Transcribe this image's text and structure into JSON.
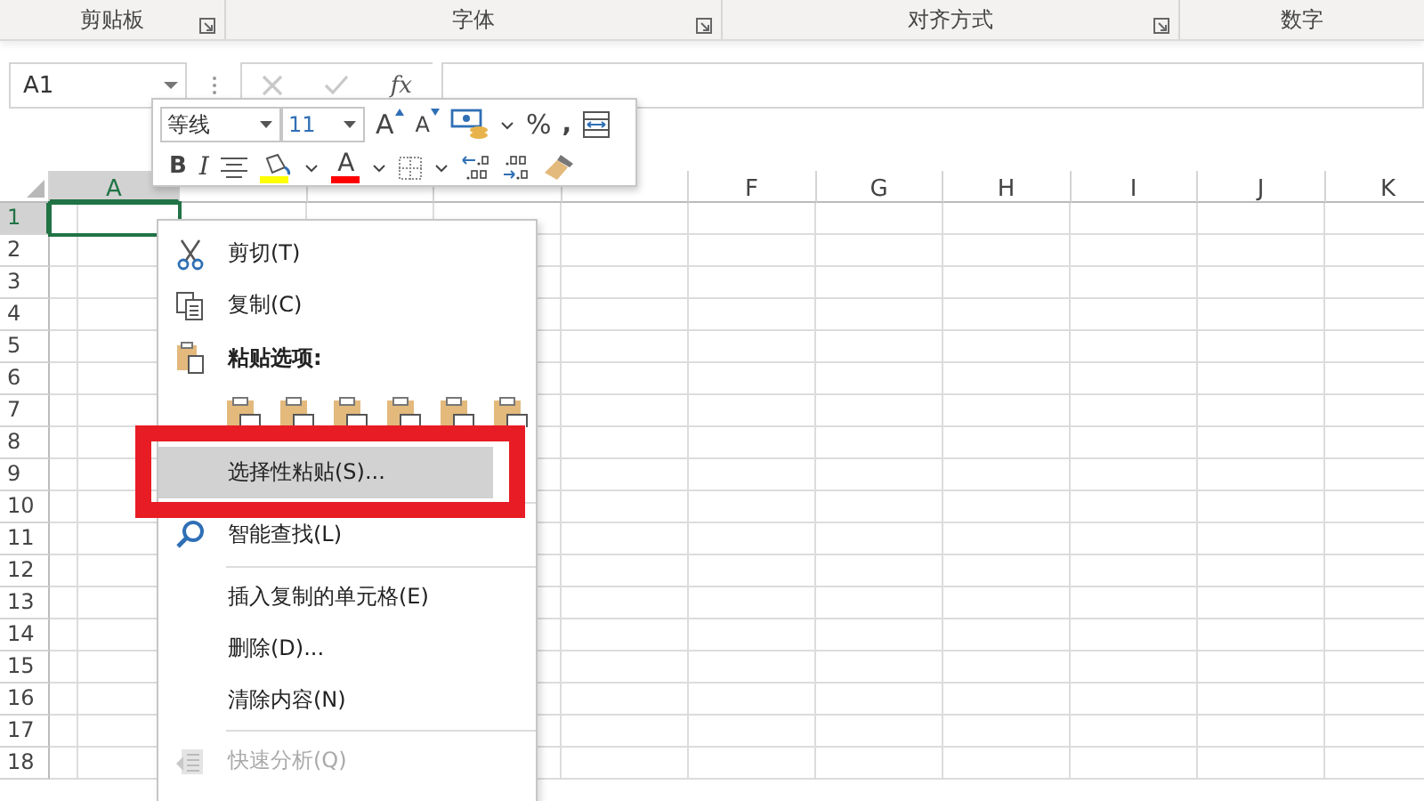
{
  "ribbon_groups": [
    {
      "label": "剪贴板",
      "launcher": true
    },
    {
      "label": "字体",
      "launcher": true
    },
    {
      "label": "对齐方式",
      "launcher": true
    },
    {
      "label": "数字",
      "launcher": false
    }
  ],
  "name_box": {
    "value": "A1"
  },
  "formula_bar": {
    "function_label": "fx"
  },
  "columns": [
    {
      "label": "A",
      "selected": true
    },
    {
      "selected": false
    },
    {
      "selected": false
    },
    {
      "selected": false
    },
    {
      "selected": false
    },
    {
      "label": "F",
      "selected": false
    },
    {
      "label": "G",
      "selected": false
    },
    {
      "label": "H",
      "selected": false
    },
    {
      "label": "I",
      "selected": false
    },
    {
      "label": "J",
      "selected": false
    },
    {
      "label": "K",
      "selected": false
    }
  ],
  "rows": [
    {
      "label": "1",
      "selected": true
    },
    {
      "label": "2",
      "selected": false
    },
    {
      "label": "3",
      "selected": false
    },
    {
      "label": "4",
      "selected": false
    },
    {
      "label": "5",
      "selected": false
    },
    {
      "label": "6",
      "selected": false
    },
    {
      "label": "7",
      "selected": false
    },
    {
      "label": "8",
      "selected": false
    },
    {
      "label": "9",
      "selected": false
    },
    {
      "label": "10",
      "selected": false
    },
    {
      "label": "11",
      "selected": false
    },
    {
      "label": "12",
      "selected": false
    },
    {
      "label": "13",
      "selected": false
    },
    {
      "label": "14",
      "selected": false
    },
    {
      "label": "15",
      "selected": false
    },
    {
      "label": "16",
      "selected": false
    },
    {
      "label": "17",
      "selected": false
    },
    {
      "label": "18",
      "selected": false
    }
  ],
  "mini_toolbar": {
    "font_name": "等线",
    "font_size": "11",
    "percent": "%",
    "comma": ",",
    "bold": "B",
    "italic": "I",
    "grow_font": "A",
    "shrink_font": "A",
    "font_color_label": "A"
  },
  "context_menu": [
    {
      "kind": "command",
      "label": "剪切(T)",
      "selected": false,
      "disabled": false,
      "framed": false
    },
    {
      "kind": "command",
      "label": "复制(C)",
      "selected": false,
      "disabled": false,
      "framed": false
    },
    {
      "kind": "header",
      "label": "粘贴选项:"
    },
    {
      "kind": "paste_options"
    },
    {
      "kind": "command",
      "label": "选择性粘贴(S)...",
      "selected": true,
      "disabled": false,
      "framed": true
    },
    {
      "kind": "separator"
    },
    {
      "kind": "command",
      "label": "智能查找(L)",
      "selected": false,
      "disabled": false,
      "framed": false
    },
    {
      "kind": "separator"
    },
    {
      "kind": "command",
      "label": "插入复制的单元格(E)",
      "selected": false,
      "disabled": false,
      "framed": false
    },
    {
      "kind": "command",
      "label": "删除(D)...",
      "selected": false,
      "disabled": false,
      "framed": false
    },
    {
      "kind": "command",
      "label": "清除内容(N)",
      "selected": false,
      "disabled": false,
      "framed": false
    },
    {
      "kind": "separator"
    },
    {
      "kind": "command",
      "label": "快速分析(Q)",
      "selected": false,
      "disabled": true,
      "framed": false
    }
  ]
}
